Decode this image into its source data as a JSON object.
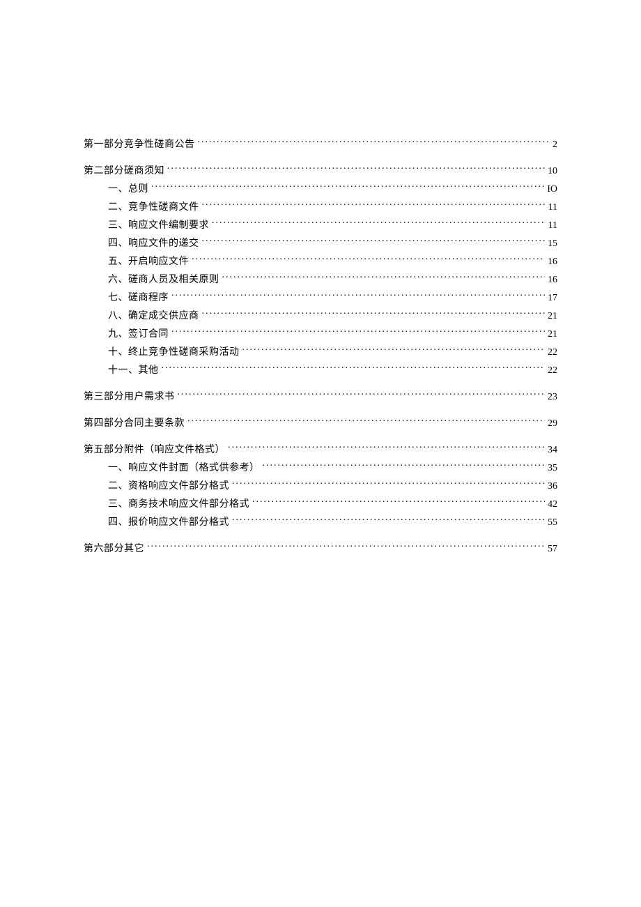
{
  "toc": {
    "sections": [
      {
        "label": "第一部分竞争性磋商公告",
        "page": "2",
        "children": []
      },
      {
        "label": "第二部分磋商须知",
        "page": "10",
        "children": [
          {
            "label": "一、总则",
            "page": "IO"
          },
          {
            "label": "二、竞争性磋商文件",
            "page": "11"
          },
          {
            "label": "三、响应文件编制要求",
            "page": "11"
          },
          {
            "label": "四、响应文件的递交",
            "page": "15"
          },
          {
            "label": "五、开启响应文件",
            "page": "16"
          },
          {
            "label": "六、磋商人员及相关原则",
            "page": "16"
          },
          {
            "label": "七、磋商程序",
            "page": "17"
          },
          {
            "label": "八、确定成交供应商",
            "page": "21"
          },
          {
            "label": "九、签订合同",
            "page": "21"
          },
          {
            "label": "十、终止竞争性磋商采购活动",
            "page": "22"
          },
          {
            "label": "十一、其他",
            "page": "22"
          }
        ]
      },
      {
        "label": "第三部分用户需求书",
        "page": "23",
        "children": []
      },
      {
        "label": "第四部分合同主要条款",
        "page": "29",
        "children": []
      },
      {
        "label": "第五部分附件（响应文件格式）",
        "page": "34",
        "children": [
          {
            "label": "一、响应文件封面（格式供参考）",
            "page": "35"
          },
          {
            "label": "二、资格响应文件部分格式",
            "page": "36"
          },
          {
            "label": "三、商务技术响应文件部分格式",
            "page": "42"
          },
          {
            "label": "四、报价响应文件部分格式",
            "page": "55"
          }
        ]
      },
      {
        "label": "第六部分其它",
        "page": "57",
        "children": []
      }
    ]
  }
}
